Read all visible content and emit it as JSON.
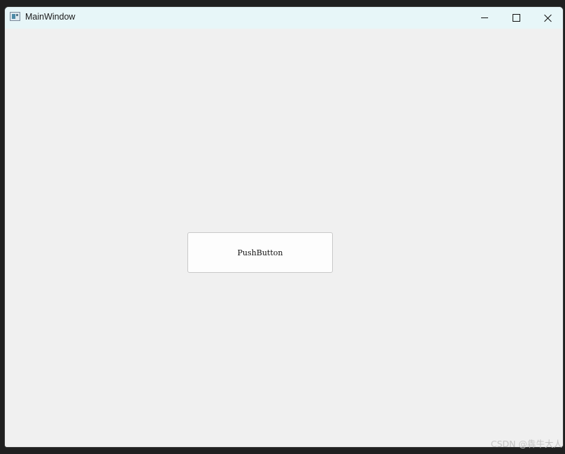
{
  "window": {
    "title": "MainWindow",
    "controls": {
      "minimize": "minimize",
      "maximize": "maximize",
      "close": "close"
    }
  },
  "main": {
    "push_button_label": "PushButton"
  },
  "watermark": "CSDN @犇牛大人"
}
